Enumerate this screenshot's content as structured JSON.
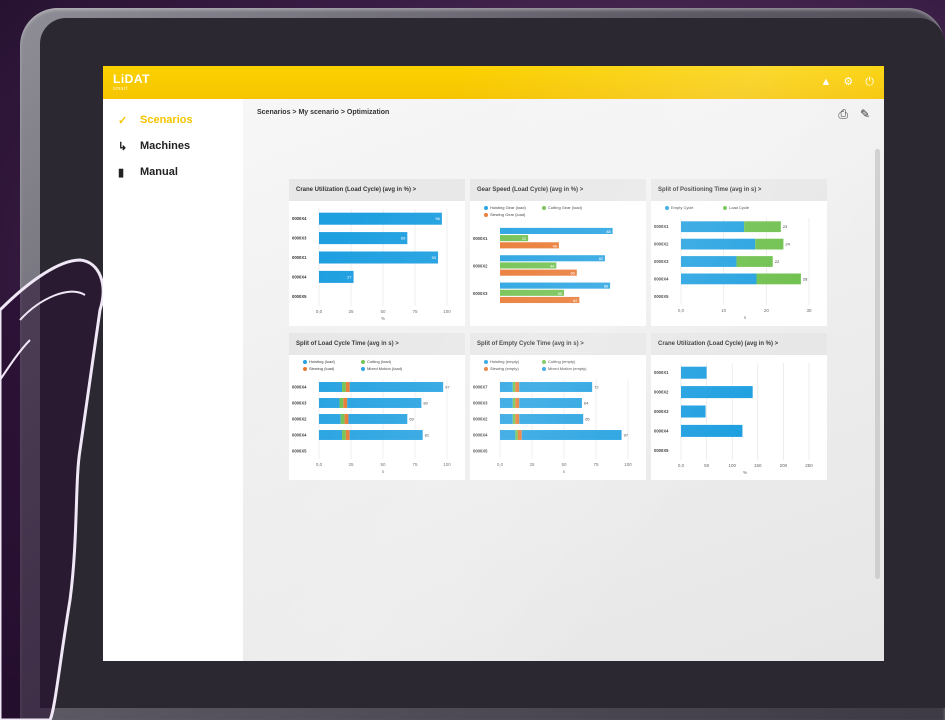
{
  "app": {
    "logo": "LiDAT",
    "logo_sub": "smart"
  },
  "colors": {
    "accent": "#f6c400",
    "blue": "#1e9fe0",
    "green": "#6cbf4a",
    "orange": "#e8742c",
    "gray_bar": "#c9c9c9"
  },
  "header_icons": [
    "user-icon",
    "settings-icon",
    "power-icon"
  ],
  "sidebar": {
    "items": [
      {
        "label": "Scenarios",
        "icon": "chart-line-icon",
        "active": true
      },
      {
        "label": "Machines",
        "icon": "crane-icon",
        "active": false
      },
      {
        "label": "Manual",
        "icon": "book-icon",
        "active": false
      }
    ]
  },
  "breadcrumb": "Scenarios > My scenario > Optimization",
  "toolbar": {
    "print_icon": "print-icon",
    "edit_icon": "edit-icon"
  },
  "panels": [
    {
      "title": "Crane Utilization (Load Cycle) (avg in %) >"
    },
    {
      "title": "Gear Speed (Load Cycle) (avg in %) >"
    },
    {
      "title": "Split of Positioning Time (avg in s) >"
    },
    {
      "title": "Split of Load Cycle Time (avg in s) >"
    },
    {
      "title": "Split of Empty Cycle Time (avg in s) >"
    },
    {
      "title": "Crane Utilization (Load Cycle) (avg in %) >"
    }
  ],
  "chart_data": [
    {
      "type": "bar",
      "orientation": "horizontal",
      "title": "Crane Utilization (Load Cycle) (avg in %) >",
      "categories": [
        "0000X4",
        "0000X3",
        "0000X1",
        "0000X4",
        "0000X5"
      ],
      "values": [
        96,
        69,
        93,
        27,
        0
      ],
      "value_labels": [
        "96",
        "69",
        "93",
        "27",
        ""
      ],
      "xlabel": "%",
      "xticks": [
        "0,0",
        "25",
        "50",
        "75",
        "100"
      ],
      "xlim": [
        0,
        100
      ],
      "grid": true
    },
    {
      "type": "bar",
      "orientation": "horizontal",
      "title": "Gear Speed (Load Cycle) (avg in %) >",
      "legend": [
        "Hoisting Gear (load)",
        "Cutting Gear (load)",
        "Slewing Gear (load)"
      ],
      "categories": [
        "0000X1",
        "0000X2",
        "0000X3"
      ],
      "series": [
        {
          "name": "Hoisting Gear (load)",
          "values": [
            88,
            82,
            86
          ],
          "color": "blue"
        },
        {
          "name": "Cutting Gear (load)",
          "values": [
            22,
            44,
            50
          ],
          "color": "green"
        },
        {
          "name": "Slewing Gear (load)",
          "values": [
            46,
            60,
            62
          ],
          "color": "orange"
        }
      ],
      "value_labels": [
        [
          "88",
          "22",
          "46"
        ],
        [
          "82",
          "44",
          "60"
        ],
        [
          "86",
          "50",
          "62"
        ]
      ],
      "xlim": [
        0,
        100
      ]
    },
    {
      "type": "bar",
      "orientation": "horizontal",
      "stacked": true,
      "title": "Split of Positioning Time (avg in s) >",
      "legend": [
        "Empty Cycle",
        "Load Cycle"
      ],
      "categories": [
        "0000X1",
        "0000X2",
        "0000X3",
        "0000X4",
        "0000X5"
      ],
      "series": [
        {
          "name": "Empty Cycle",
          "values": [
            14.8,
            17.4,
            13,
            17.7,
            0
          ],
          "color": "blue"
        },
        {
          "name": "Load Cycle",
          "values": [
            8.6,
            6.6,
            8.5,
            10.4,
            0
          ],
          "color": "green"
        }
      ],
      "totals": [
        "23",
        "24",
        "22",
        "28",
        ""
      ],
      "xticks": [
        "0,0",
        "10",
        "20",
        "30"
      ],
      "xlim": [
        0,
        30
      ],
      "xlabel": "s"
    },
    {
      "type": "bar",
      "orientation": "horizontal",
      "stacked": true,
      "title": "Split of Load Cycle Time (avg in s) >",
      "legend": [
        "Hoisting (load)",
        "Cutting (load)",
        "Slewing (load)",
        "Mixed Motion (load)"
      ],
      "categories": [
        "0000X4",
        "0000X3",
        "0000X2",
        "0000X4",
        "0000X5"
      ],
      "series": [
        {
          "name": "Hoisting (load)",
          "values": [
            18,
            16,
            17,
            18,
            0
          ],
          "color": "blue"
        },
        {
          "name": "Cutting (load)",
          "values": [
            3,
            3,
            3,
            3,
            0
          ],
          "color": "green"
        },
        {
          "name": "Slewing (load)",
          "values": [
            3,
            3,
            3,
            3,
            0
          ],
          "color": "orange"
        },
        {
          "name": "Mixed Motion (load)",
          "values": [
            73,
            58,
            46,
            57,
            0
          ],
          "color": "blue"
        }
      ],
      "totals": [
        "97",
        "80",
        "69",
        "81",
        ""
      ],
      "xticks": [
        "0,0",
        "25",
        "50",
        "75",
        "100"
      ],
      "xlim": [
        0,
        100
      ],
      "xlabel": "s"
    },
    {
      "type": "bar",
      "orientation": "horizontal",
      "stacked": true,
      "title": "Split of Empty Cycle Time (avg in s) >",
      "legend": [
        "Hoisting (empty)",
        "Cutting (empty)",
        "Slewing (empty)",
        "Mixed Motion (empty)"
      ],
      "categories": [
        "0000X7",
        "0000X3",
        "0000X2",
        "0000X4",
        "0000X5"
      ],
      "series": [
        {
          "name": "Hoisting (empty)",
          "values": [
            10,
            10,
            10,
            12,
            0
          ],
          "color": "blue"
        },
        {
          "name": "Cutting (empty)",
          "values": [
            2,
            2,
            2,
            2,
            0
          ],
          "color": "green"
        },
        {
          "name": "Slewing (empty)",
          "values": [
            3,
            3,
            3,
            3,
            0
          ],
          "color": "orange"
        },
        {
          "name": "Mixed Motion (empty)",
          "values": [
            57,
            49,
            50,
            78,
            0
          ],
          "color": "blue"
        }
      ],
      "totals": [
        "72",
        "64",
        "65",
        "97",
        ""
      ],
      "xticks": [
        "0,0",
        "25",
        "50",
        "75",
        "100"
      ],
      "xlim": [
        0,
        100
      ],
      "xlabel": "s"
    },
    {
      "type": "bar",
      "orientation": "horizontal",
      "title": "Crane Utilization (Load Cycle) (avg in %) >",
      "categories": [
        "0000X1",
        "0000X2",
        "0000X3",
        "0000X4",
        "0000X5"
      ],
      "values": [
        50,
        140,
        48,
        120,
        0
      ],
      "value_labels": [
        "",
        "",
        "",
        "",
        ""
      ],
      "xticks": [
        "0,0",
        "50",
        "100",
        "150",
        "200",
        "250"
      ],
      "xlim": [
        0,
        250
      ],
      "xlabel": "%"
    }
  ]
}
